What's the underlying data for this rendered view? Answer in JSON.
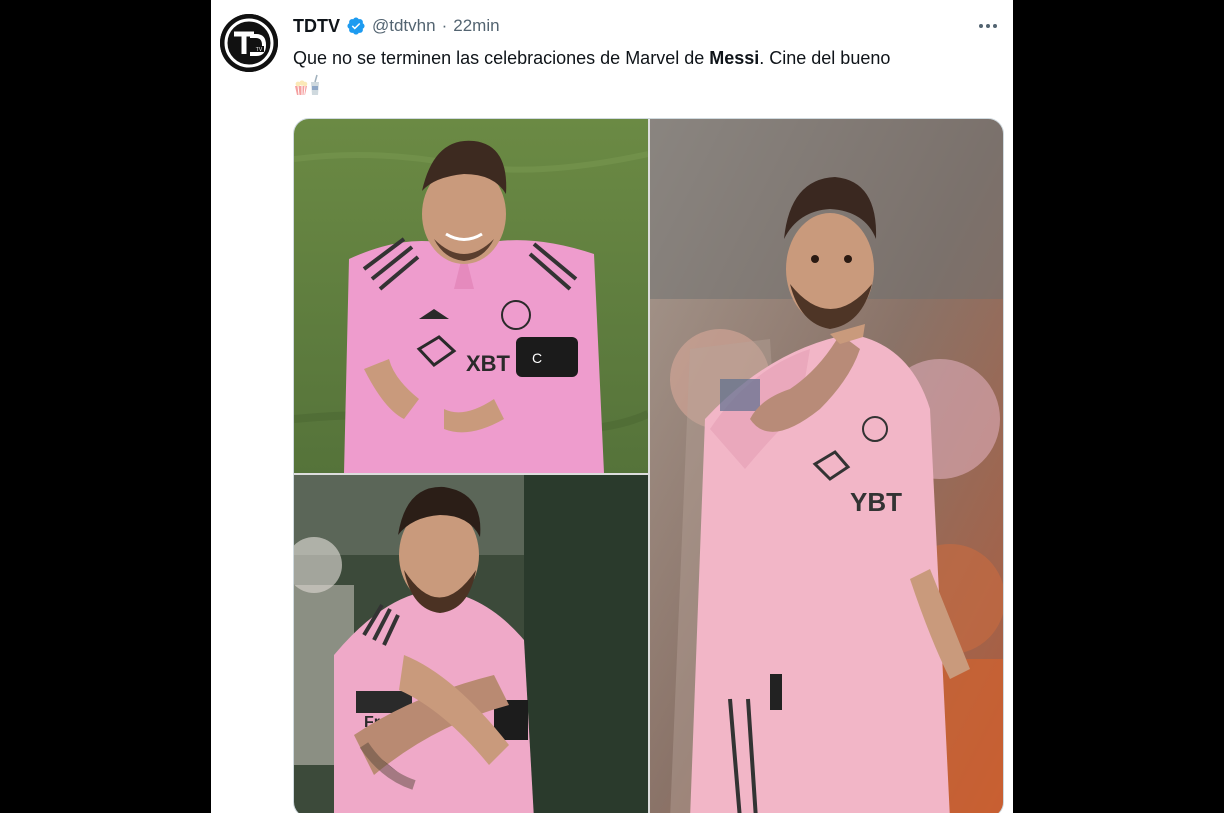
{
  "tweet": {
    "author": {
      "display_name": "TDTV",
      "handle": "@tdtvhn",
      "avatar_text": "TDTV",
      "verified": true
    },
    "separator": "·",
    "time": "22min",
    "text": {
      "before": "Que no se terminen las celebraciones de Marvel de ",
      "bold": "Messi",
      "after": ". Cine del bueno"
    },
    "emoji": "popcorn-and-drink-emoji",
    "media": [
      {
        "name": "photo-celebration-hands",
        "jersey_text": "XBT"
      },
      {
        "name": "photo-pointing-gesture",
        "jersey_text": "YBT"
      },
      {
        "name": "photo-crossed-arms",
        "jersey_text": "Fracht"
      }
    ]
  },
  "colors": {
    "accent": "#1d9bf0",
    "text": "#0f1419",
    "secondary": "#536471",
    "jersey_pink": "#f0a8cf",
    "pitch_green": "#5f7d3e"
  }
}
